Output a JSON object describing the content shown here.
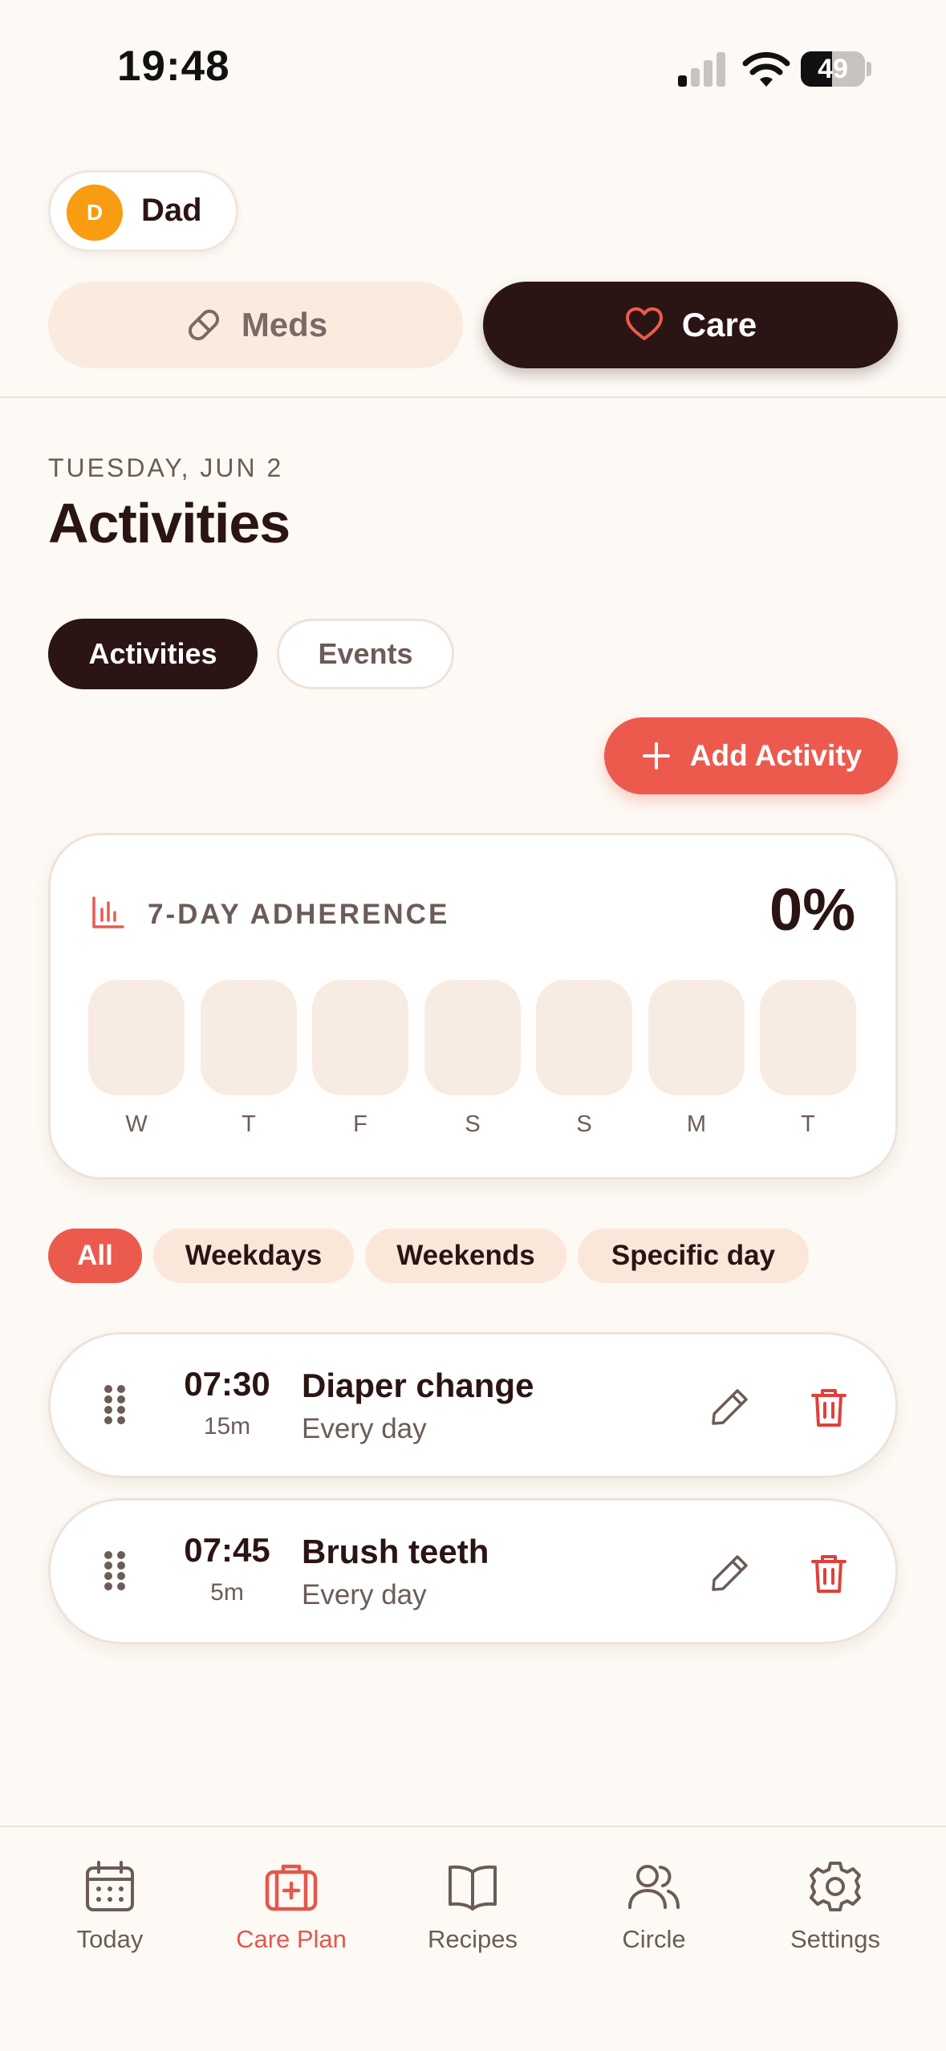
{
  "status_bar": {
    "time": "19:48",
    "battery": "49"
  },
  "profile": {
    "initial": "D",
    "name": "Dad"
  },
  "mode_toggle": {
    "meds_label": "Meds",
    "care_label": "Care",
    "active": "Care"
  },
  "header": {
    "date": "TUESDAY, JUN 2",
    "title": "Activities"
  },
  "segments": {
    "activities_label": "Activities",
    "events_label": "Events",
    "active": "Activities"
  },
  "add_button": {
    "label": "Add Activity"
  },
  "adherence": {
    "title": "7-DAY ADHERENCE",
    "percent": "0%",
    "days": [
      "W",
      "T",
      "F",
      "S",
      "S",
      "M",
      "T"
    ]
  },
  "filters": {
    "all": "All",
    "weekdays": "Weekdays",
    "weekends": "Weekends",
    "specific_day": "Specific day",
    "active": "All"
  },
  "activities": [
    {
      "time": "07:30",
      "duration": "15m",
      "name": "Diaper change",
      "frequency": "Every day"
    },
    {
      "time": "07:45",
      "duration": "5m",
      "name": "Brush teeth",
      "frequency": "Every day"
    }
  ],
  "nav": {
    "today": "Today",
    "care_plan": "Care Plan",
    "recipes": "Recipes",
    "circle": "Circle",
    "settings": "Settings",
    "active": "Care Plan"
  },
  "colors": {
    "accent": "#ec5a4e",
    "dark": "#2b1414",
    "background": "#fdf9f4",
    "avatar": "#f89c12"
  }
}
